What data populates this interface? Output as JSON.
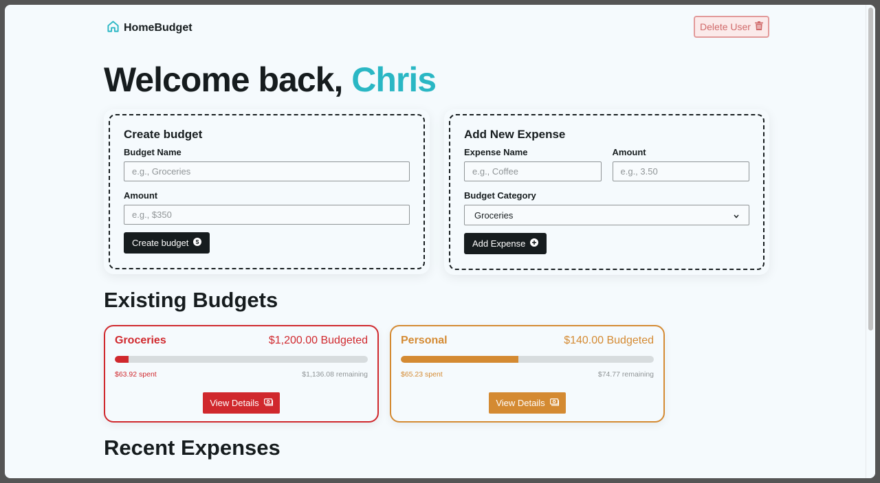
{
  "header": {
    "brand": "HomeBudget",
    "brand_icon": "home-icon",
    "delete_user_label": "Delete User",
    "delete_user_icon": "trash-icon"
  },
  "welcome": {
    "prefix": "Welcome back,",
    "name": "Chris"
  },
  "create_budget": {
    "title": "Create budget",
    "name_label": "Budget Name",
    "name_placeholder": "e.g., Groceries",
    "amount_label": "Amount",
    "amount_placeholder": "e.g., $350",
    "button_label": "Create budget",
    "button_icon": "dollar-circle-icon"
  },
  "add_expense": {
    "title": "Add New Expense",
    "name_label": "Expense Name",
    "name_placeholder": "e.g., Coffee",
    "amount_label": "Amount",
    "amount_placeholder": "e.g., 3.50",
    "category_label": "Budget Category",
    "category_selected": "Groceries",
    "button_label": "Add Expense",
    "button_icon": "plus-circle-icon"
  },
  "existing_budgets": {
    "title": "Existing Budgets",
    "budgets": [
      {
        "name": "Groceries",
        "budgeted": "$1,200.00 Budgeted",
        "spent": "$63.92 spent",
        "remaining": "$1,136.08 remaining",
        "progress_fraction": 0.0533,
        "color": "#d0282d",
        "button_label": "View Details",
        "button_icon": "banknote-icon"
      },
      {
        "name": "Personal",
        "budgeted": "$140.00 Budgeted",
        "spent": "$65.23 spent",
        "remaining": "$74.77 remaining",
        "progress_fraction": 0.466,
        "color": "#d48a32",
        "button_label": "View Details",
        "button_icon": "banknote-icon"
      }
    ]
  },
  "recent_expenses": {
    "title": "Recent Expenses"
  },
  "colors": {
    "accent": "#2ab7c4",
    "dark": "#161c1e",
    "danger": "#d0282d"
  }
}
